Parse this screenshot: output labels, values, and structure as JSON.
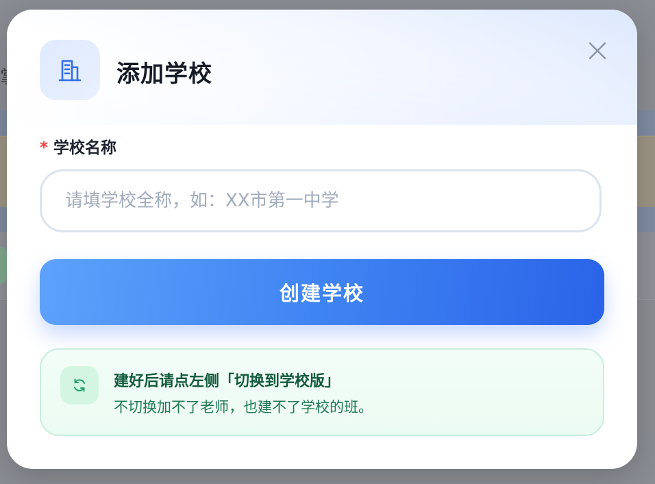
{
  "background": {
    "partial_glyph": "掌"
  },
  "modal": {
    "title": "添加学校",
    "title_icon": "building-icon",
    "close_icon": "close-icon",
    "field": {
      "required_mark": "*",
      "label": "学校名称",
      "value": "",
      "placeholder": "请填学校全称，如：XX市第一中学"
    },
    "submit_label": "创建学校",
    "tip": {
      "icon": "refresh-icon",
      "title": "建好后请点左侧「切换到学校版」",
      "description": "不切换加不了老师，也建不了学校的班。"
    }
  },
  "colors": {
    "accent": "#3f84f3",
    "required": "#ef4444",
    "tip_bg": "#ecfbf3",
    "tip_text": "#135b3c"
  }
}
